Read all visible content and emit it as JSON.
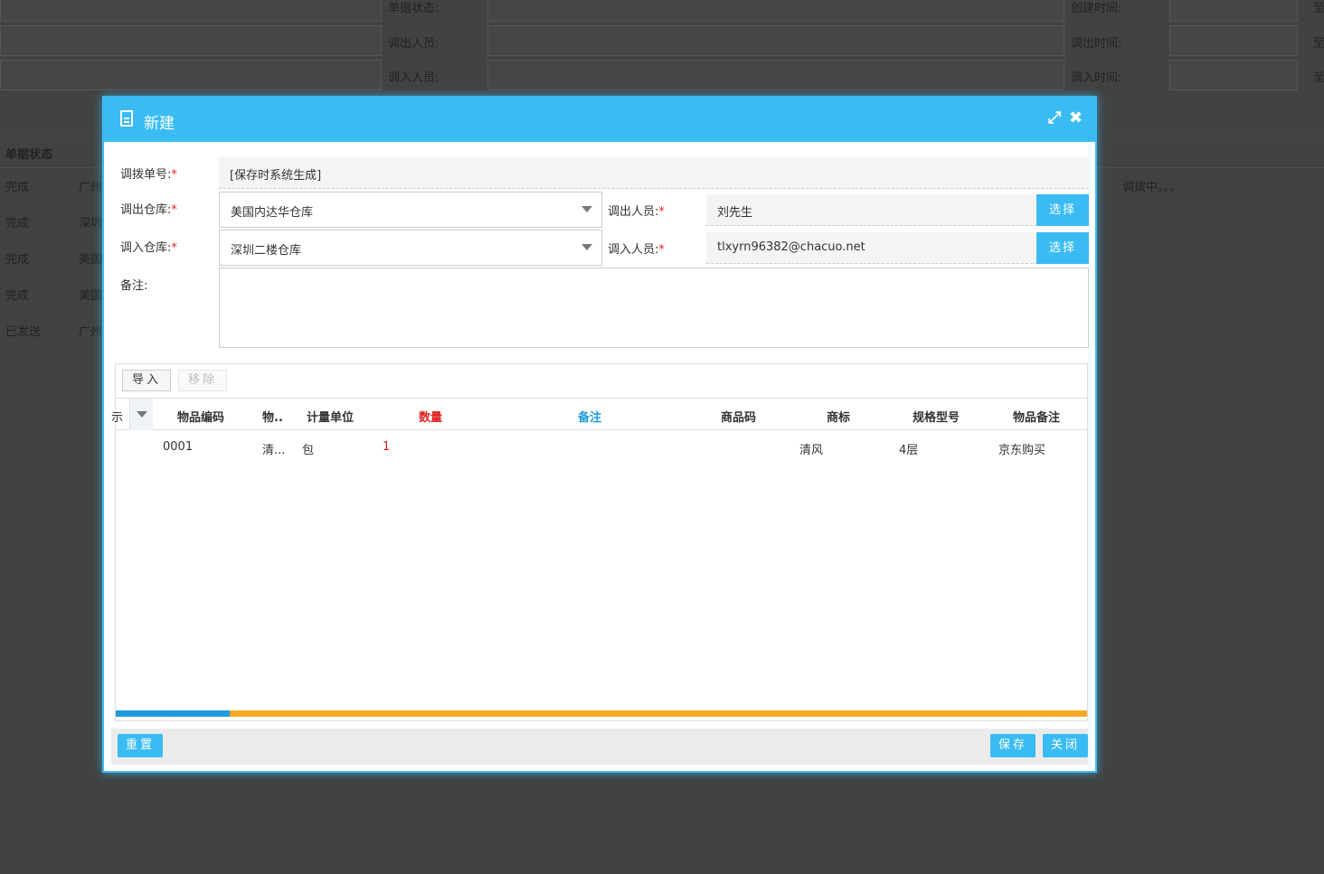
{
  "background": {
    "filters": [
      {
        "label": "单据状态:",
        "date_label": "创建时间:",
        "to": "至"
      },
      {
        "label": "调出人员:",
        "date_label": "调出时间:",
        "to": "至"
      },
      {
        "label": "调入人员:",
        "date_label": "调入时间:",
        "to": "至"
      }
    ],
    "list_header": "单据状态",
    "rows": [
      {
        "status": "完成",
        "warehouse": "广州",
        "note": "调拨中。。。"
      },
      {
        "status": "完成",
        "warehouse": "深圳",
        "note": ""
      },
      {
        "status": "完成",
        "warehouse": "美国",
        "note": ""
      },
      {
        "status": "完成",
        "warehouse": "美国",
        "note": ""
      },
      {
        "status": "已发送",
        "warehouse": "广州",
        "note": ""
      }
    ]
  },
  "modal": {
    "title": "新建",
    "form": {
      "order_no_label": "调拨单号:",
      "order_no_value": "[保存时系统生成]",
      "out_wh_label": "调出仓库:",
      "out_wh_value": "美国内达华仓库",
      "in_wh_label": "调入仓库:",
      "in_wh_value": "深圳二楼仓库",
      "out_person_label": "调出人员:",
      "out_person_value": "刘先生",
      "in_person_label": "调入人员:",
      "in_person_value": "tlxyrn96382@chacuo.net",
      "select_label": "选择",
      "remark_label": "备注:",
      "required_mark": "*"
    },
    "grid": {
      "toolbar": {
        "import": "导入",
        "remove": "移除"
      },
      "first_col_fragment": "示",
      "columns": [
        "物品编码",
        "物..",
        "计量单位",
        "数量",
        "备注",
        "商品码",
        "商标",
        "规格型号",
        "物品备注"
      ],
      "rows": [
        {
          "code": "0001",
          "name": "清...",
          "unit": "包",
          "qty": "1",
          "remark": "",
          "barcode": "",
          "brand": "清风",
          "spec": "4层",
          "item_remark": "京东购买"
        }
      ],
      "progress_blue_fraction": 0.117
    },
    "footer": {
      "reset": "重置",
      "save": "保存",
      "close": "关闭"
    }
  }
}
